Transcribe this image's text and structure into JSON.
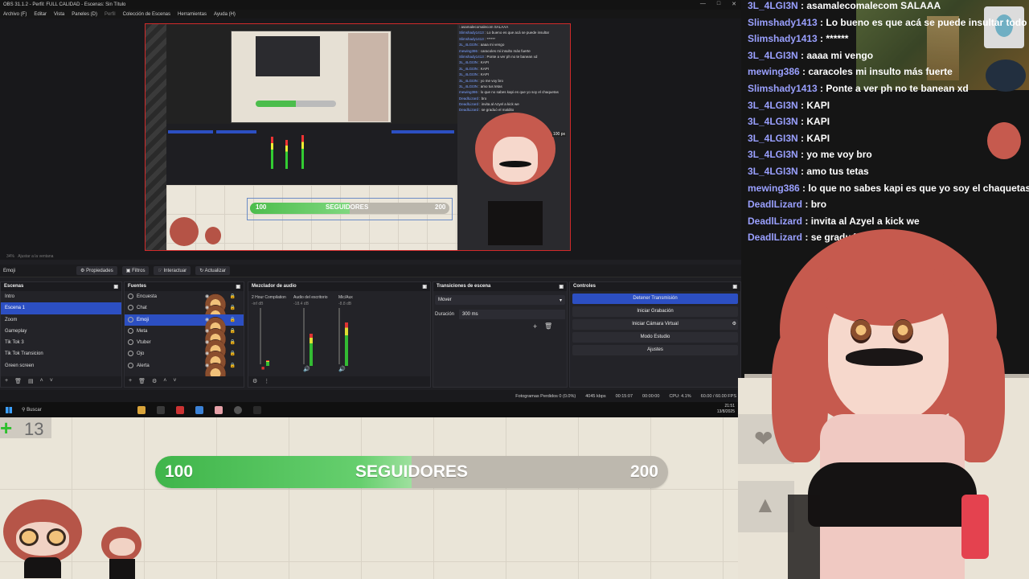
{
  "obs": {
    "title": "OBS 31.1.2 - Perfil: FULL CALIDAD - Escenas: Sin Título",
    "menu": [
      "Archivo (F)",
      "Editar",
      "Vista",
      "Paneles (D)",
      "Perfil",
      "Colección de Escenas",
      "Herramientas",
      "Ayuda (H)"
    ],
    "preview": {
      "zoom": "34%",
      "fit": "Ajustar a la ventana",
      "mini_follow": {
        "start": "100",
        "label": "SEGUIDORES",
        "end": "200",
        "progress": 0.5
      },
      "px_label": "100 px",
      "mini_chat": [
        {
          "user": "",
          "text": "asamalecomalecom SALAAA"
        },
        {
          "user": "Slimshady1413",
          "text": "Lo bueno es que acá se puede insultar"
        },
        {
          "user": "Slimshady1413",
          "text": "******"
        },
        {
          "user": "3L_4LGI3N",
          "text": "aaaa mi vengo"
        },
        {
          "user": "mewing386",
          "text": "caracoles mi insulto más fuerte"
        },
        {
          "user": "Slimshady1413",
          "text": "Ponte a ver ph no te banean xd"
        },
        {
          "user": "3L_4LGI3N",
          "text": "KAPI"
        },
        {
          "user": "3L_4LGI3N",
          "text": "KAPI"
        },
        {
          "user": "3L_4LGI3N",
          "text": "KAPI"
        },
        {
          "user": "3L_4LGI3N",
          "text": "yo me voy bro"
        },
        {
          "user": "3L_4LGI3N",
          "text": "amo tus tetas"
        },
        {
          "user": "mewing386",
          "text": "lo que no sabes kapi es que yo soy el chaquetas"
        },
        {
          "user": "DeadlLizard",
          "text": "bro"
        },
        {
          "user": "DeadlLizard",
          "text": "invita al Azyel a kick we"
        },
        {
          "user": "DeadlLizard",
          "text": "se graduó el maldito"
        }
      ]
    },
    "toolbar": {
      "source": "Emoji",
      "properties": "Propiedades",
      "filters": "Filtros",
      "interact": "Interactuar",
      "refresh": "Actualizar"
    },
    "scenes": {
      "title": "Escenas",
      "items": [
        "Intro",
        "Escena 1",
        "Zoom",
        "Gameplay",
        "Tik Tok 3",
        "Tik Tok Transicion",
        "Green screen"
      ],
      "selected": "Escena 1"
    },
    "sources": {
      "title": "Fuentes",
      "items": [
        "Encuesta",
        "Chat",
        "Emoji",
        "Meta",
        "Vtuber",
        "Ojo",
        "Alerta"
      ],
      "selected": "Emoji"
    },
    "mixer": {
      "title": "Mezclador de audio",
      "channels": [
        {
          "name": "2 Hour Compilation",
          "db": "-inf dB",
          "level": 0.1
        },
        {
          "name": "Audio del escritorio",
          "db": "-18.4 dB",
          "level": 0.55
        },
        {
          "name": "Mic/Aux",
          "db": "-8.8 dB",
          "level": 0.75
        }
      ]
    },
    "transitions": {
      "title": "Transiciones de escena",
      "selected": "Mover",
      "duration_label": "Duración",
      "duration": "300 ms"
    },
    "controls": {
      "title": "Controles",
      "buttons": [
        "Detener Transmisión",
        "Iniciar Grabación",
        "Iniciar Cámara Virtual",
        "Modo Estudio",
        "Ajustes"
      ]
    },
    "status": {
      "dropped": "Fotogramas Perdidos 0 (0.0%)",
      "bitrate": "4045 kbps",
      "stream_time": "00:15:07",
      "rec_time": "00:00:00",
      "cpu": "CPU: 4.1%",
      "fps": "60.00 / 60.00 FPS"
    }
  },
  "taskbar": {
    "search": "Buscar",
    "time": "21:51",
    "date": "13/8/2025"
  },
  "overlay": {
    "counter": "13",
    "follow": {
      "start": "100",
      "label": "SEGUIDORES",
      "end": "200",
      "progress": 0.5
    }
  },
  "chat": [
    {
      "user": "3L_4LGI3N",
      "text": "asamalecomalecom SALAAA"
    },
    {
      "user": "Slimshady1413",
      "text": "Lo bueno es que acá se puede insultar todo lo po"
    },
    {
      "user": "Slimshady1413",
      "text": "******"
    },
    {
      "user": "3L_4LGI3N",
      "text": "aaaa mi vengo"
    },
    {
      "user": "mewing386",
      "text": "caracoles mi insulto más fuerte"
    },
    {
      "user": "Slimshady1413",
      "text": "Ponte a ver ph no te banean xd"
    },
    {
      "user": "3L_4LGI3N",
      "text": "KAPI"
    },
    {
      "user": "3L_4LGI3N",
      "text": "KAPI"
    },
    {
      "user": "3L_4LGI3N",
      "text": "KAPI"
    },
    {
      "user": "3L_4LGI3N",
      "text": "yo me voy bro"
    },
    {
      "user": "3L_4LGI3N",
      "text": "amo tus tetas"
    },
    {
      "user": "mewing386",
      "text": "lo que no sabes kapi es que yo soy el chaquetas 🔥"
    },
    {
      "user": "DeadlLizard",
      "text": "bro"
    },
    {
      "user": "DeadlLizard",
      "text": "invita al Azyel a kick we"
    },
    {
      "user": "DeadlLizard",
      "text": "se graduó el maldito"
    }
  ],
  "colors": {
    "accent": "#2c4fc2",
    "progress_green": "#4cbd4c",
    "chat_user": "#9aa0ff",
    "live_border": "#d12a2a"
  },
  "icons": [
    "heart-icon",
    "bell-icon",
    "windows-start-icon",
    "search-icon",
    "eye-icon",
    "lock-icon",
    "gear-icon",
    "plus-icon"
  ]
}
